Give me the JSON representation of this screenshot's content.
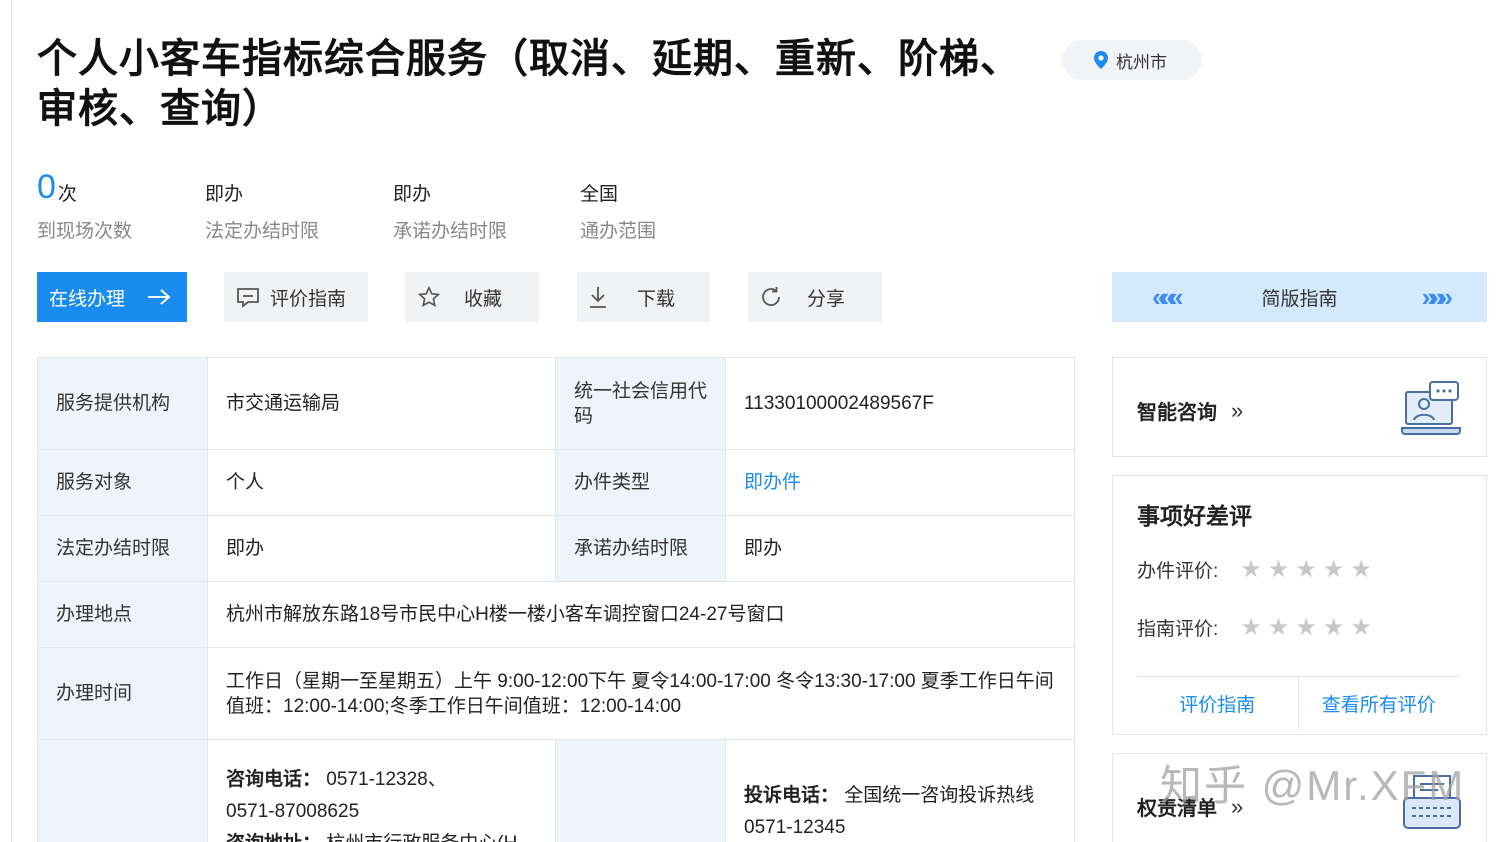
{
  "title": "个人小客车指标综合服务（取消、延期、重新、阶梯、审核、查询）",
  "location": "杭州市",
  "stats": [
    {
      "value": "0",
      "unit": "次",
      "label": "到现场次数"
    },
    {
      "value": "即办",
      "label": "法定办结时限"
    },
    {
      "value": "即办",
      "label": "承诺办结时限"
    },
    {
      "value": "全国",
      "label": "通办范围"
    }
  ],
  "buttons": {
    "online": "在线办理",
    "evaluate": "评价指南",
    "favorite": "收藏",
    "download": "下载",
    "share": "分享"
  },
  "guide": {
    "label": "简版指南",
    "prev": "«««",
    "next": "»»»"
  },
  "info": {
    "provider_label": "服务提供机构",
    "provider": "市交通运输局",
    "credit_label": "统一社会信用代码",
    "credit": "11330100002489567F",
    "target_label": "服务对象",
    "target": "个人",
    "type_label": "办件类型",
    "type": "即办件",
    "legal_limit_label": "法定办结时限",
    "legal_limit": "即办",
    "promise_limit_label": "承诺办结时限",
    "promise_limit": "即办",
    "place_label": "办理地点",
    "place": "杭州市解放东路18号市民中心H楼一楼小客车调控窗口24-27号窗口",
    "time_label": "办理时间",
    "time": "工作日（星期一至星期五）上午 9:00-12:00下午 夏令14:00-17:00 冬令13:30-17:00 夏季工作日午间值班：12:00-14:00;冬季工作日午间值班：12:00-14:00",
    "consult_phone_label": "咨询电话：",
    "consult_phone_1": "0571-12328、",
    "consult_phone_2": "0571-87008625",
    "consult_addr_label": "咨询地址：",
    "consult_addr": "杭州市行政服务中心(H",
    "complaint_label": "投诉电话：",
    "complaint_1": "全国统一咨询投诉热线",
    "complaint_2": "0571-12345"
  },
  "smart_consult": {
    "title": "智能咨询",
    "arrow": "»"
  },
  "rating": {
    "title": "事项好差评",
    "item_label": "办件评价:",
    "item_stars": 0,
    "guide_label": "指南评价:",
    "guide_stars": 0,
    "link_guide": "评价指南",
    "link_all": "查看所有评价"
  },
  "rights": {
    "title": "权责清单",
    "arrow": "»"
  },
  "watermark": "知乎 @Mr.XFM",
  "colors": {
    "accent": "#1a8cf0",
    "label_bg": "#eef4fc",
    "guide_bg": "#d4e9fb"
  }
}
